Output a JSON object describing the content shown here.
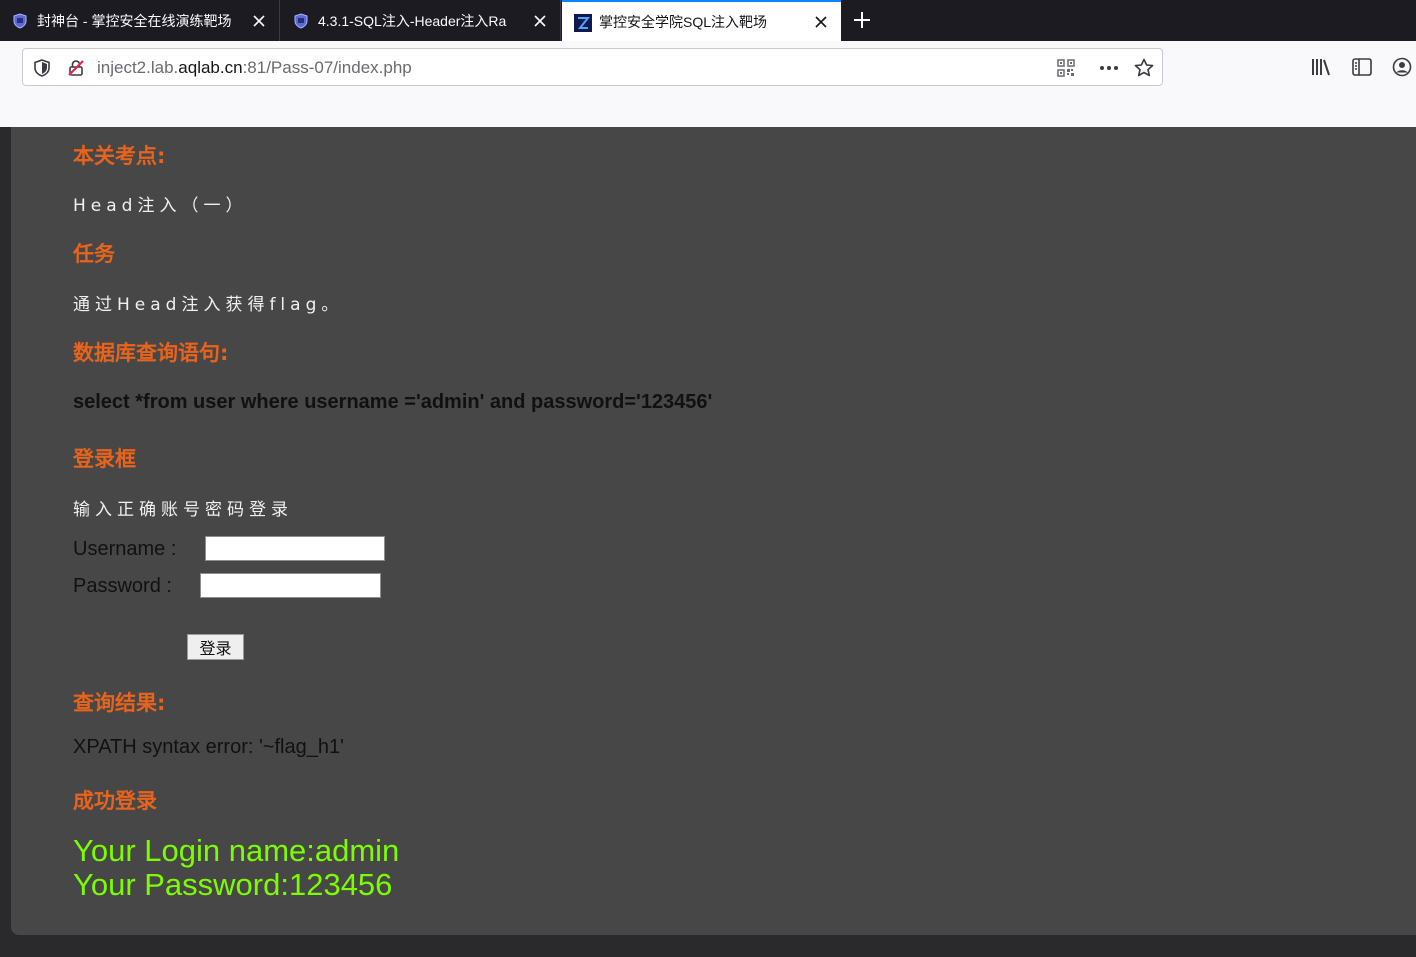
{
  "browser": {
    "tabs": [
      {
        "title": "封神台 - 掌控安全在线演练靶场",
        "active": false,
        "icon": "shield-favicon"
      },
      {
        "title": "4.3.1-SQL注入-Header注入Ra",
        "active": false,
        "icon": "shield-favicon"
      },
      {
        "title": "掌控安全学院SQL注入靶场",
        "active": true,
        "icon": "zk-logo-favicon"
      }
    ],
    "url_prefix": "inject2.lab.",
    "url_domain": "aqlab.cn",
    "url_suffix": ":81/Pass-07/index.php"
  },
  "page": {
    "section_points": "本关考点:",
    "points_text": "Head注入（一）",
    "section_task": "任务",
    "task_text": "通过Head注入获得flag。",
    "section_query": "数据库查询语句:",
    "query_text": "select *from user where username ='admin' and password='123456'",
    "section_login": "登录框",
    "login_hint": "输入正确账号密码登录",
    "username_label": "Username :",
    "username_value": "",
    "password_label": "Password :",
    "password_value": "",
    "login_button": "登录",
    "section_result": "查询结果:",
    "result_text": "XPATH syntax error: '~flag_h1'",
    "section_success": "成功登录",
    "login_name_line": "Your Login name:admin",
    "password_line": "Your Password:123456"
  }
}
